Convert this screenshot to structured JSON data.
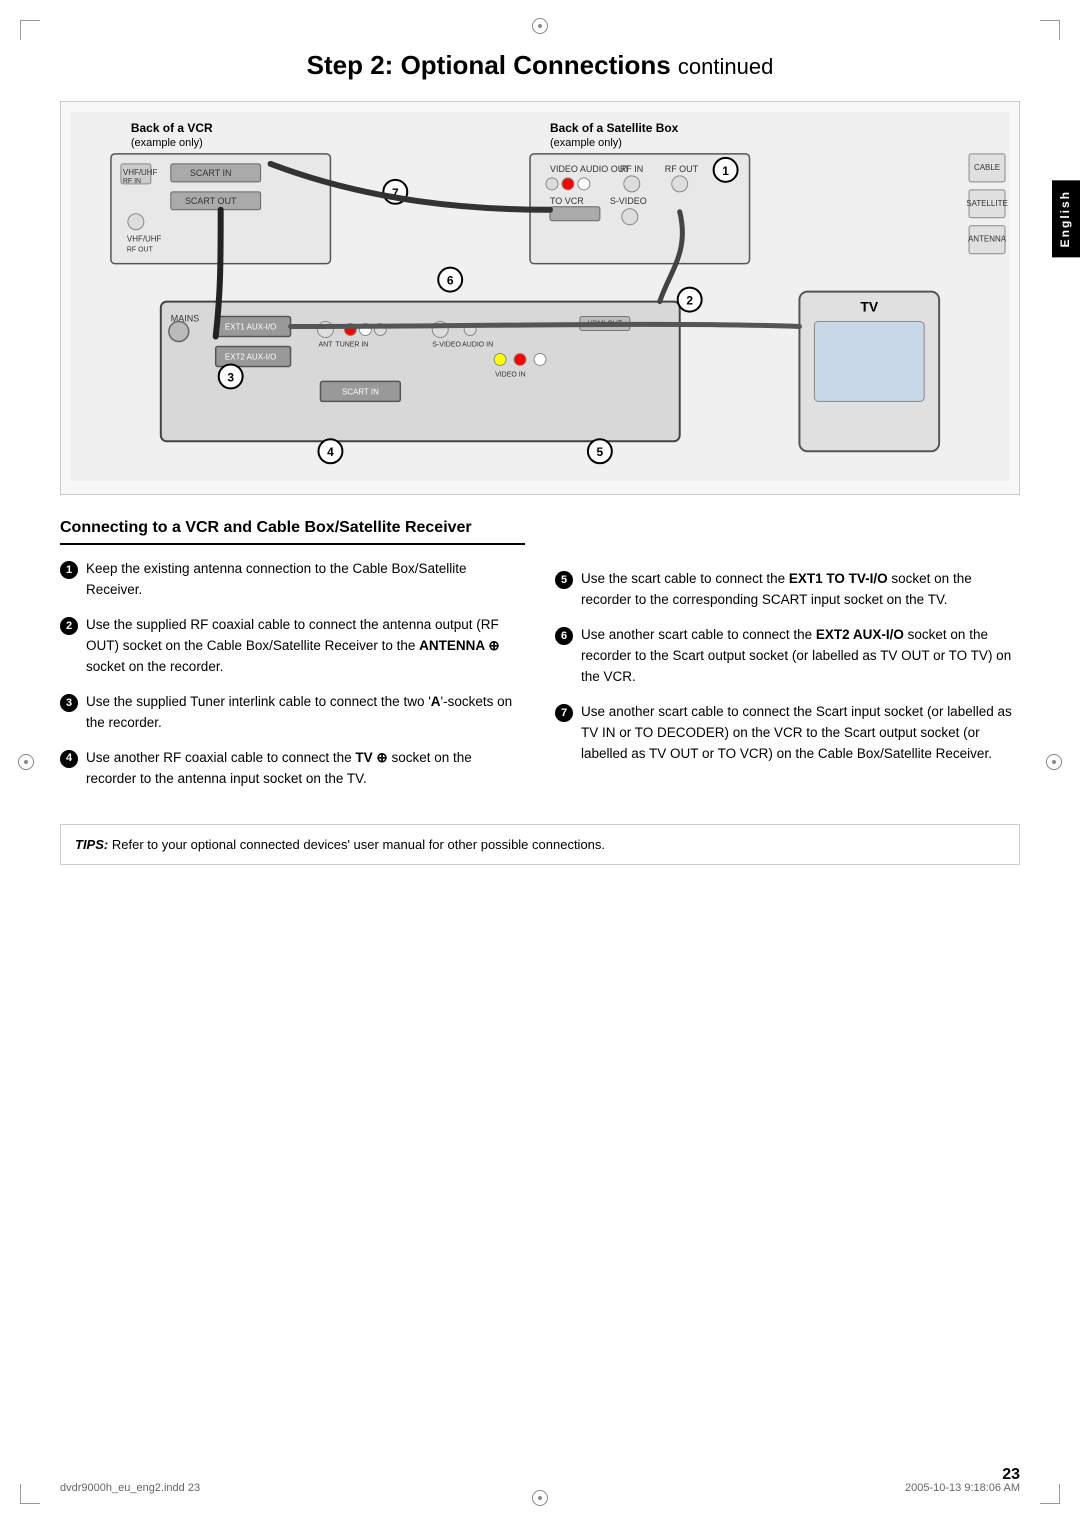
{
  "page": {
    "title": "Step 2: Optional Connections",
    "title_suffix": "continued",
    "english_tab": "English"
  },
  "section": {
    "heading": "Connecting to a VCR and Cable Box/Satellite Receiver"
  },
  "steps_left": [
    {
      "number": "1",
      "text": "Keep the existing antenna connection to the Cable Box/Satellite Receiver."
    },
    {
      "number": "2",
      "text": "Use the supplied RF coaxial cable to connect the antenna output (RF OUT) socket on the Cable Box/Satellite Receiver to the ",
      "bold": "ANTENNA ⊕",
      "text2": " socket on the recorder."
    },
    {
      "number": "3",
      "text": "Use the supplied Tuner interlink cable to connect the two '",
      "bold": "A",
      "text2": "'-sockets on the recorder."
    },
    {
      "number": "4",
      "text": "Use another RF coaxial cable to connect the ",
      "bold": "TV ⊕",
      "text2": " socket on the recorder to the antenna input socket on the TV."
    }
  ],
  "steps_right": [
    {
      "number": "5",
      "text": "Use the scart cable to connect the ",
      "bold": "EXT1 TO TV-I/O",
      "text2": " socket on the recorder to the corresponding SCART input socket on the TV."
    },
    {
      "number": "6",
      "text": "Use another scart cable to connect the ",
      "bold": "EXT2 AUX-I/O",
      "text2": " socket on the recorder to the Scart output socket (or labelled as TV OUT or TO TV) on the VCR."
    },
    {
      "number": "7",
      "text": "Use another scart cable to connect the Scart input socket (or labelled as TV IN or TO DECODER) on the VCR to the Scart output socket (or labelled as TV OUT or TO VCR) on the Cable Box/Satellite Receiver."
    }
  ],
  "tips": {
    "label": "TIPS:",
    "text": "Refer to your optional connected devices' user manual for other possible connections."
  },
  "footer": {
    "left": "dvdr9000h_eu_eng2.indd  23",
    "right": "2005-10-13  9:18:06 AM",
    "page_number": "23"
  },
  "diagram": {
    "vcr_label": "Back of a VCR",
    "vcr_sublabel": "(example only)",
    "satellite_label": "Back of a Satellite Box",
    "satellite_sublabel": "(example only)",
    "tv_label": "TV",
    "scart_in": "SCART IN",
    "scart_out": "SCART OUT",
    "rf_in": "RF IN",
    "rf_out": "RF OUT",
    "s_video": "S-VIDEO",
    "audio_in": "AUDIO IN",
    "video_in": "VIDEO IN",
    "scart_in2": "SCART IN",
    "mains": "MAINS",
    "hdmi_out": "HDMI OUT"
  }
}
